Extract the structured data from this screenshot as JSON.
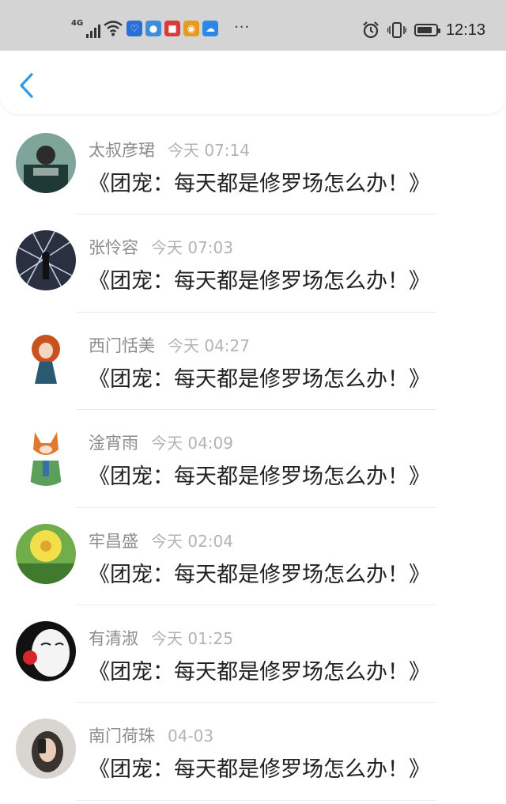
{
  "status_bar": {
    "network": "4G",
    "time": "12:13",
    "battery_level": 0.8,
    "app_icons": [
      {
        "name": "security-app-icon",
        "glyph": "♡",
        "color": "#2a6fd6"
      },
      {
        "name": "browser-app-icon",
        "glyph": "●",
        "color": "#3b8fd9"
      },
      {
        "name": "reader-app-icon",
        "glyph": "■",
        "color": "#d93a3a"
      },
      {
        "name": "weibo-app-icon",
        "glyph": "◉",
        "color": "#e89a20"
      },
      {
        "name": "weather-app-icon",
        "glyph": "☁",
        "color": "#2b88e6"
      }
    ],
    "more": "···"
  },
  "nav": {
    "back_icon": "chevron-left-icon",
    "accent_color": "#2f9ae0"
  },
  "messages": [
    {
      "name": "太叔彦珺",
      "time": "今天 07:14",
      "text": "《团宠：每天都是修罗场怎么办！》"
    },
    {
      "name": "张怜容",
      "time": "今天 07:03",
      "text": "《团宠：每天都是修罗场怎么办！》"
    },
    {
      "name": "西门恬美",
      "time": "今天 04:27",
      "text": "《团宠：每天都是修罗场怎么办！》"
    },
    {
      "name": "淦宵雨",
      "time": "今天 04:09",
      "text": "《团宠：每天都是修罗场怎么办！》"
    },
    {
      "name": "牢昌盛",
      "time": "今天 02:04",
      "text": "《团宠：每天都是修罗场怎么办！》"
    },
    {
      "name": "有清淑",
      "time": "今天 01:25",
      "text": "《团宠：每天都是修罗场怎么办！》"
    },
    {
      "name": "南门荷珠",
      "time": "04-03",
      "text": "《团宠：每天都是修罗场怎么办！》"
    }
  ]
}
